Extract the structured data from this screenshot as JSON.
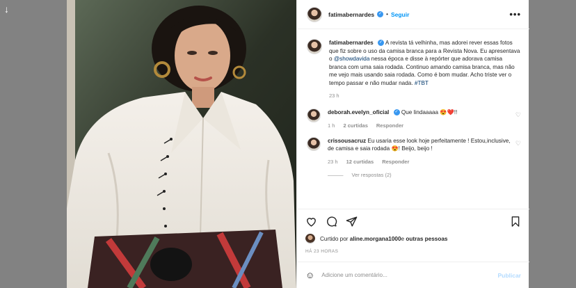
{
  "post": {
    "username": "fatimabernardes",
    "verified_mark": "✓",
    "dot": "•",
    "follow_label": "Seguir",
    "more_label": "•••",
    "caption_parts": {
      "a": "A revista tá velhinha, mas adorei rever essas fotos que fiz sobre o uso da camisa branca para a Revista Nova. Eu apresentava o ",
      "mention": "@showdavida",
      "b": " nessa época e disse à repórter que adorava camisa branca com uma saia rodada. Continuo amando camisa branca, mas não me vejo mais usando saia rodada. Como é bom mudar. Acho triste ver o tempo passar e não mudar nada. ",
      "hashtag": "#TBT"
    },
    "caption_time": "23 h"
  },
  "comments": [
    {
      "username": "deborah.evelyn_oficial",
      "verified": true,
      "text": "Que lindaaaaa 😍❤️!!",
      "time": "1 h",
      "likes": "2 curtidas",
      "reply": "Responder"
    },
    {
      "username": "crissousacruz",
      "verified": false,
      "text": "Eu usaria esse look hoje perfeitamente ! Estou,inclusive, de camisa e saia rodada 😍! Beijo, beijo !",
      "time": "23 h",
      "likes": "12 curtidas",
      "reply": "Responder",
      "view_replies": "Ver respostas (2)"
    }
  ],
  "likes_line": {
    "prefix": "Curtido por ",
    "user": "aline.morgana1000",
    "middle": " e ",
    "rest": "outras pessoas"
  },
  "timestamp": "HÁ 23 HORAS",
  "composer": {
    "placeholder": "Adicione um comentário...",
    "emoji": "☺",
    "publish_label": "Publicar"
  },
  "icons": [
    "heart-icon",
    "comment-icon",
    "share-icon",
    "bookmark-icon",
    "emoji-icon"
  ],
  "colors": {
    "accent": "#0095f6",
    "verified": "#3897f0",
    "muted": "#8e8e8e"
  },
  "page_arrow": "↓"
}
